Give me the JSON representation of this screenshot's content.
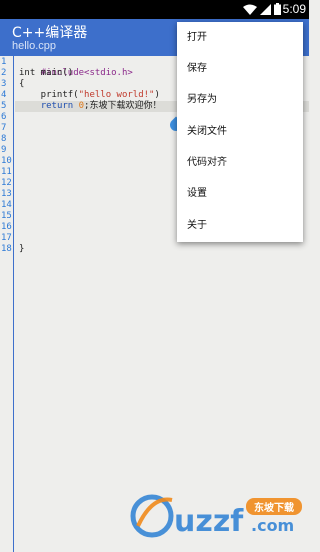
{
  "status_bar": {
    "time": "5:09",
    "icons": [
      "wifi-icon",
      "cell-signal-icon",
      "battery-icon"
    ]
  },
  "app_bar": {
    "title": "C++编译器",
    "subtitle": "hello.cpp"
  },
  "editor": {
    "line_numbers": [
      "1",
      "2",
      "3",
      "4",
      "5",
      "6",
      "7",
      "8",
      "9",
      "10",
      "11",
      "12",
      "13",
      "14",
      "15",
      "16",
      "17",
      "18"
    ],
    "code": {
      "l1": "#include<stdio.h>",
      "l2": "int main()",
      "l3": "{",
      "l4_call": "    printf(",
      "l4_string": "\"hello world!\"",
      "l4_tail": ")",
      "l5_indent": "    ",
      "l5_keyword": "return",
      "l5_space": " ",
      "l5_number": "0",
      "l5_text": ";东坡下载欢迎你！",
      "l18": "}"
    }
  },
  "menu": {
    "items": [
      "打开",
      "保存",
      "另存为",
      "关闭文件",
      "代码对齐",
      "设置",
      "关于"
    ]
  },
  "watermark": {
    "logo_text": "uzzf.com",
    "badge_text": "东坡下载"
  },
  "colors": {
    "app_bar": "#3d6fcb",
    "editor_bg": "#eeeeec",
    "line_number": "#2e7ad6",
    "string": "#c0392b",
    "keyword": "#1f4fb0"
  }
}
